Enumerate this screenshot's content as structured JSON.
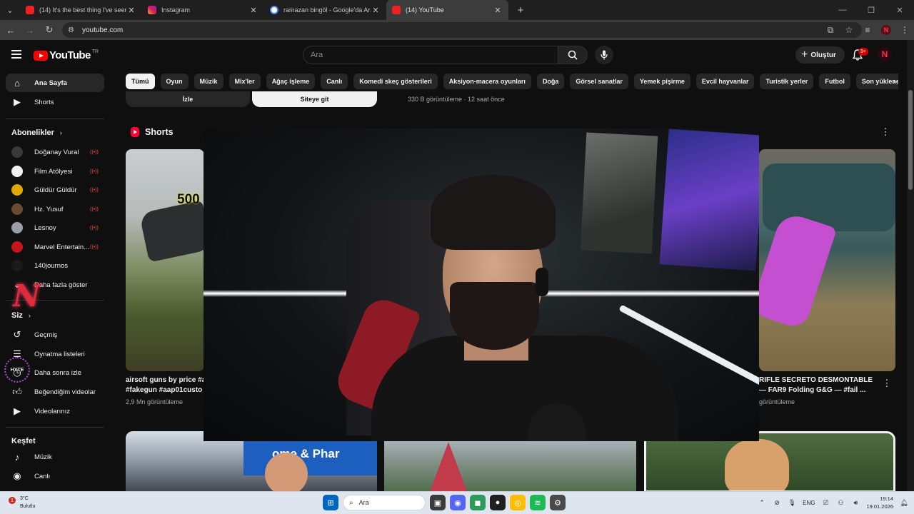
{
  "browser": {
    "tabs": [
      {
        "title": "(14) It's the best thing I've seen",
        "favicon": "youtube-favicon",
        "active": false
      },
      {
        "title": "Instagram",
        "favicon": "instagram-favicon",
        "active": false
      },
      {
        "title": "ramazan bingöl - Google'da Ara",
        "favicon": "google-favicon",
        "active": false
      },
      {
        "title": "(14) YouTube",
        "favicon": "youtube-favicon",
        "active": true
      }
    ],
    "url": "youtube.com"
  },
  "masthead": {
    "logo_text": "YouTube",
    "country_code": "TR",
    "search_placeholder": "Ara",
    "create_label": "Oluştur",
    "notification_count": "9+"
  },
  "sidebar": {
    "primary": [
      {
        "label": "Ana Sayfa",
        "icon": "home-icon",
        "active": true
      },
      {
        "label": "Shorts",
        "icon": "shorts-icon",
        "active": false
      }
    ],
    "subscriptions_header": "Abonelikler",
    "subscriptions": [
      {
        "label": "Doğanay Vural",
        "color": "#3a3a3a",
        "live": true
      },
      {
        "label": "Film Atölyesi",
        "color": "#f1f1f1",
        "live": true
      },
      {
        "label": "Güldür Güldür",
        "color": "#e0a800",
        "live": true
      },
      {
        "label": "Hz. Yusuf",
        "color": "#6b4a2e",
        "live": true
      },
      {
        "label": "Lesnoy",
        "color": "#9aa0a6",
        "live": true
      },
      {
        "label": "Marvel Entertain...",
        "color": "#c4161c",
        "live": true
      },
      {
        "label": "140journos",
        "color": "#1a1a1a",
        "live": false
      }
    ],
    "show_more": "Daha fazla göster",
    "you_header": "Siz",
    "you_items": [
      {
        "label": "Geçmiş",
        "icon": "history-icon"
      },
      {
        "label": "Oynatma listeleri",
        "icon": "playlist-icon"
      },
      {
        "label": "Daha sonra izle",
        "icon": "watch-later-icon"
      },
      {
        "label": "Beğendiğim videolar",
        "icon": "thumbs-up-icon"
      },
      {
        "label": "Videolarınız",
        "icon": "your-videos-icon"
      }
    ],
    "explore_header": "Keşfet",
    "explore_items": [
      {
        "label": "Müzik",
        "icon": "music-icon"
      },
      {
        "label": "Canlı",
        "icon": "live-icon"
      }
    ]
  },
  "chips": [
    "Tümü",
    "Oyun",
    "Müzik",
    "Mix'ler",
    "Ağaç işleme",
    "Canlı",
    "Komedi skeç gösterileri",
    "Aksiyon-macera oyunları",
    "Doğa",
    "Görsel sanatlar",
    "Yemek pişirme",
    "Evcil hayvanlar",
    "Turistik yerler",
    "Futbol",
    "Son yüklenen"
  ],
  "ad": {
    "watch_label": "İzle",
    "site_label": "Siteye git",
    "meta": "330 B görüntüleme · 12 saat önce"
  },
  "shorts": {
    "header": "Shorts",
    "items": [
      {
        "title_line1": "airsoft guns by price #a",
        "title_line2": "#fakegun #aap01custo",
        "views": "2,9 Mn görüntüleme",
        "price_text": "500"
      },
      {
        "title_line1": "RIFLE SECRETO DESMONTABLE",
        "title_line2": "— FAR9 Folding G&G — #fail ...",
        "views": "görüntüleme"
      }
    ]
  },
  "bottom_videos": [
    {
      "sign_text": "ome & Phar"
    },
    {},
    {}
  ],
  "overlay": {
    "brand_letter": "N",
    "hyte_label": "HYTE"
  },
  "taskbar": {
    "weather_temp": "3°C",
    "weather_desc": "Bulutlu",
    "weather_badge": "1",
    "search_label": "Ara",
    "language": "ENG",
    "time": "19:14",
    "date": "19.01.2026"
  }
}
